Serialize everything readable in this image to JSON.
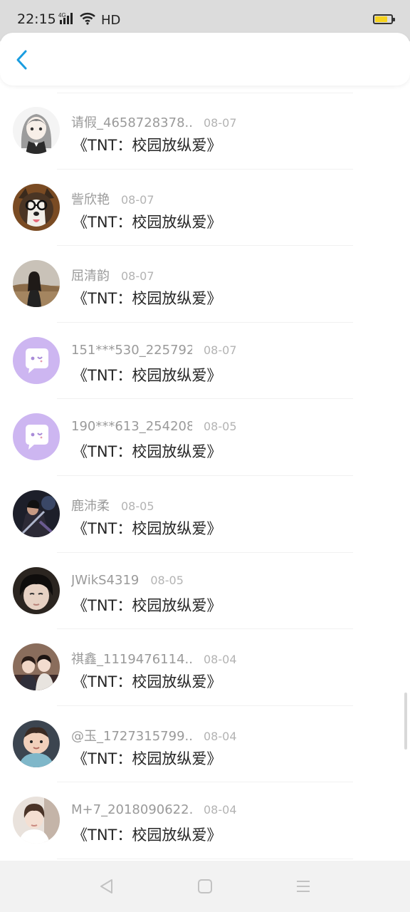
{
  "status_bar": {
    "time": "22:15",
    "network_label": "4G",
    "hd_label": "HD",
    "battery_level": 0.75,
    "battery_color": "#f5d21e"
  },
  "header": {
    "back_icon": "chevron-left-icon",
    "accent_color": "#1a9de0"
  },
  "rows": [
    {
      "name": "请假_4658728378...",
      "date": "08-07",
      "title": "《TNT：校园放纵爱》",
      "avatar": "anime-girl"
    },
    {
      "name": "訾欣艳",
      "date": "08-07",
      "title": "《TNT：校园放纵爱》",
      "avatar": "husky-dog"
    },
    {
      "name": "屈清韵",
      "date": "08-07",
      "title": "《TNT：校园放纵爱》",
      "avatar": "girl-field"
    },
    {
      "name": "151***530_225792...",
      "date": "08-07",
      "title": "《TNT：校园放纵爱》",
      "avatar": "default-chat"
    },
    {
      "name": "190***613_254208...",
      "date": "08-05",
      "title": "《TNT：校园放纵爱》",
      "avatar": "default-chat"
    },
    {
      "name": "鹿沛柔",
      "date": "08-05",
      "title": "《TNT：校园放纵爱》",
      "avatar": "game-character"
    },
    {
      "name": "JWikS4319",
      "date": "08-05",
      "title": "《TNT：校园放纵爱》",
      "avatar": "boy-portrait"
    },
    {
      "name": "祺鑫_1119476114...",
      "date": "08-04",
      "title": "《TNT：校园放纵爱》",
      "avatar": "two-boys"
    },
    {
      "name": "@玉_1727315799...",
      "date": "08-04",
      "title": "《TNT：校园放纵爱》",
      "avatar": "baby"
    },
    {
      "name": "M+7_2018090622...",
      "date": "08-04",
      "title": "《TNT：校园放纵爱》",
      "avatar": "boy-white-shirt"
    }
  ],
  "nav_bar": {
    "back_icon": "triangle-back-icon",
    "home_icon": "square-home-icon",
    "menu_icon": "menu-lines-icon"
  }
}
